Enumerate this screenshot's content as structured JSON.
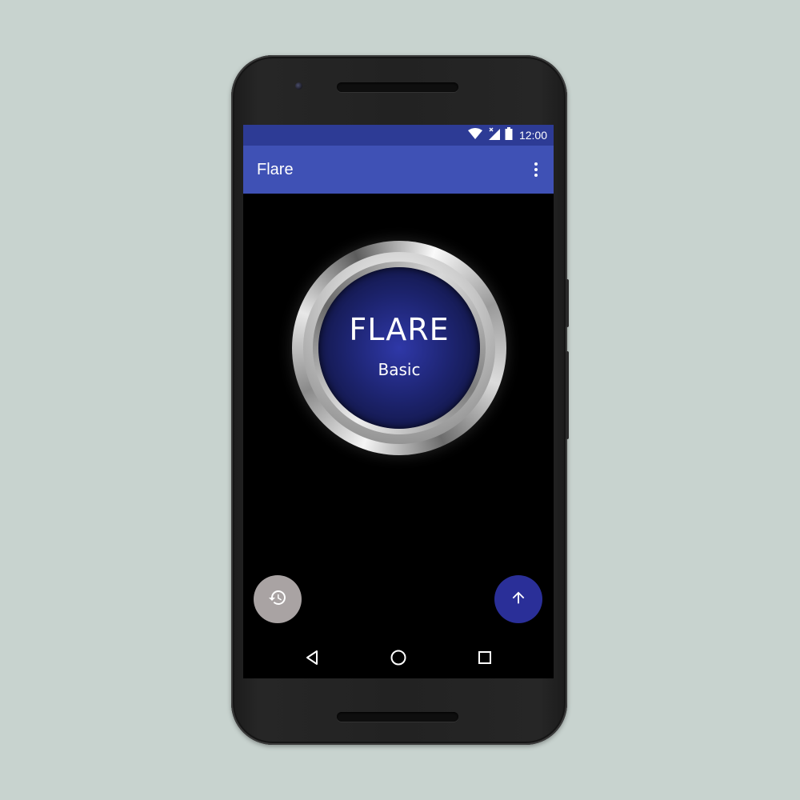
{
  "status_bar": {
    "time": "12:00",
    "icons": [
      "wifi-icon",
      "cellular-signal-icon",
      "battery-icon"
    ]
  },
  "app_bar": {
    "title": "Flare",
    "menu_icon": "overflow-menu-icon"
  },
  "flare_button": {
    "title": "FLARE",
    "subtitle": "Basic"
  },
  "fabs": {
    "history_icon": "history-icon",
    "send_icon": "arrow-up-icon"
  },
  "nav_bar": {
    "items": [
      "back-icon",
      "home-icon",
      "recents-icon"
    ]
  },
  "colors": {
    "background": "#c8d3cf",
    "status_bar": "#2d3b95",
    "app_bar": "#3f51b5",
    "screen": "#000000",
    "flare_face": "#1d2470",
    "history_fab": "#a9a3a3",
    "up_fab": "#2a2f98"
  }
}
